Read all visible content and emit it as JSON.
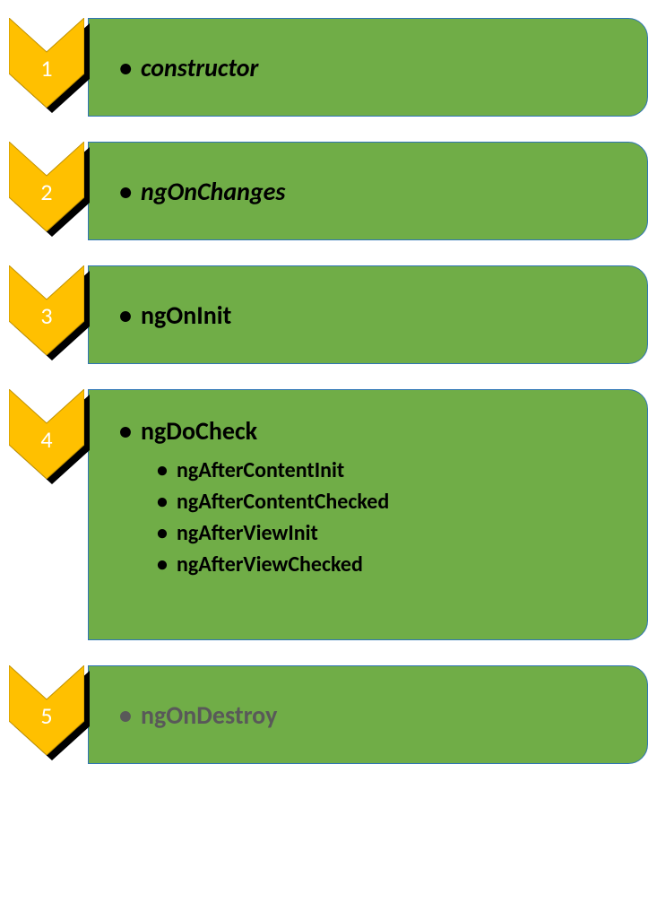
{
  "steps": [
    {
      "num": "1",
      "label": "constructor",
      "italic": true,
      "grey": false
    },
    {
      "num": "2",
      "label": "ngOnChanges",
      "italic": true,
      "grey": false
    },
    {
      "num": "3",
      "label": "ngOnInit",
      "italic": false,
      "grey": false
    },
    {
      "num": "4",
      "label": "ngDoCheck",
      "italic": false,
      "grey": false,
      "children": [
        "ngAfterContentInit",
        "ngAfterContentChecked",
        "ngAfterViewInit",
        "ngAfterViewChecked"
      ]
    },
    {
      "num": "5",
      "label": "ngOnDestroy",
      "italic": false,
      "grey": true
    }
  ]
}
